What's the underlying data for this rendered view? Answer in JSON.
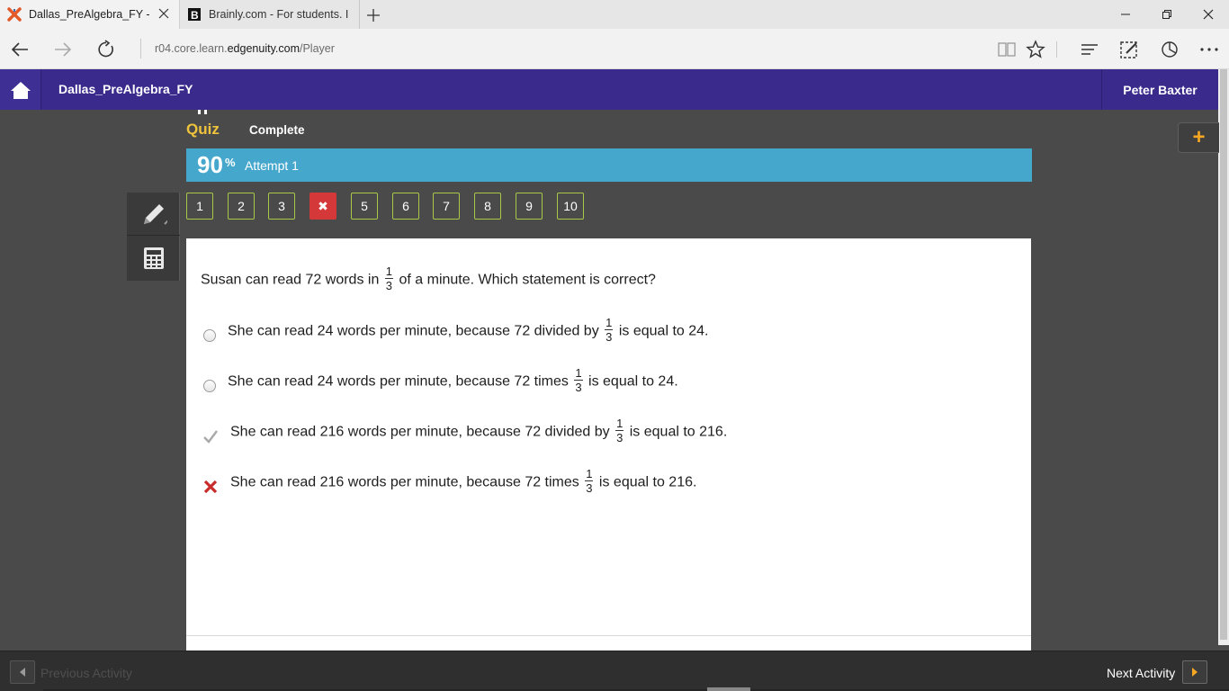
{
  "browser": {
    "tabs": [
      {
        "title": "Dallas_PreAlgebra_FY -",
        "active": true
      },
      {
        "title": "Brainly.com - For students. I",
        "active": false
      }
    ],
    "url_prefix": "r04.core.learn.",
    "url_domain": "edgenuity.com",
    "url_path": "/Player"
  },
  "header": {
    "course_title": "Dallas_PreAlgebra_FY",
    "user_name": "Peter Baxter"
  },
  "activity": {
    "type_label": "Quiz",
    "status": "Complete",
    "score": "90",
    "score_unit": "%",
    "attempt": "Attempt 1",
    "plus_label": "+"
  },
  "question_nav": [
    {
      "label": "1",
      "state": "correct"
    },
    {
      "label": "2",
      "state": "correct"
    },
    {
      "label": "3",
      "state": "correct"
    },
    {
      "label": "✖",
      "state": "wrong"
    },
    {
      "label": "5",
      "state": "correct"
    },
    {
      "label": "6",
      "state": "correct"
    },
    {
      "label": "7",
      "state": "correct"
    },
    {
      "label": "8",
      "state": "correct"
    },
    {
      "label": "9",
      "state": "correct"
    },
    {
      "label": "10",
      "state": "correct"
    }
  ],
  "question": {
    "text_before": "Susan can read 72 words in",
    "frac_num": "1",
    "frac_den": "3",
    "text_after": "of a minute. Which statement is correct?",
    "options": [
      {
        "before": "She can read 24 words per minute, because 72 divided by",
        "num": "1",
        "den": "3",
        "after": "is equal to 24.",
        "mark": "radio"
      },
      {
        "before": "She can read 24 words per minute, because 72 times",
        "num": "1",
        "den": "3",
        "after": "is equal to 24.",
        "mark": "radio"
      },
      {
        "before": "She can read 216 words per minute, because 72 divided by",
        "num": "1",
        "den": "3",
        "after": "is equal to 216.",
        "mark": "check-icon"
      },
      {
        "before": "She can read 216 words per minute, because 72 times",
        "num": "1",
        "den": "3",
        "after": "is equal to 216.",
        "mark": "x-icon"
      }
    ]
  },
  "footer": {
    "prev_label": "Previous Activity",
    "next_label": "Next Activity"
  },
  "colors": {
    "header_bg": "#3a2a8c",
    "score_bar": "#46a7cd",
    "quiz_label": "#f0c33c",
    "nav_border": "#a8c84a",
    "wrong": "#d53838",
    "accent_orange": "#f5a623"
  }
}
